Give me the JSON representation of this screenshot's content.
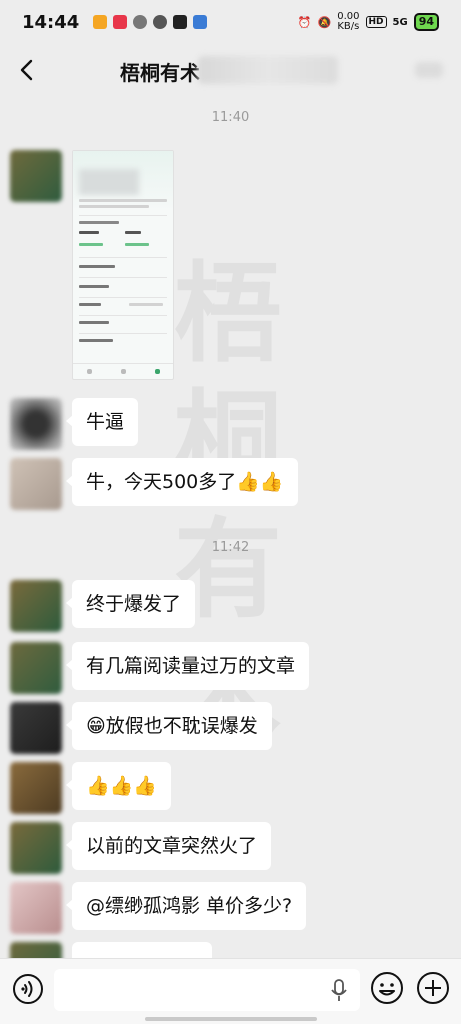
{
  "status_bar": {
    "time": "14:44",
    "net_speed_value": "0.00",
    "net_speed_unit": "KB/s",
    "hd": "HD",
    "signal": "5G",
    "battery": "94"
  },
  "header": {
    "title": "梧桐有术"
  },
  "watermark": [
    "梧",
    "桐",
    "有",
    "术"
  ],
  "chat": {
    "timestamps": [
      "11:40",
      "11:42"
    ],
    "messages": [
      {
        "type": "image"
      },
      {
        "type": "text",
        "text": "牛逼"
      },
      {
        "type": "text",
        "text": "牛，今天500多了👍👍"
      },
      {
        "type": "text",
        "text": "终于爆发了"
      },
      {
        "type": "text",
        "text": "有几篇阅读量过万的文章"
      },
      {
        "type": "text",
        "text": "😁放假也不耽误爆发"
      },
      {
        "type": "text",
        "text": "👍👍👍"
      },
      {
        "type": "text",
        "text": "以前的文章突然火了"
      },
      {
        "type": "text",
        "text": "@缥缈孤鸿影  单价多少?"
      }
    ]
  },
  "colors": {
    "background": "#ededed",
    "bubble": "#ffffff",
    "battery": "#6fd84f"
  }
}
